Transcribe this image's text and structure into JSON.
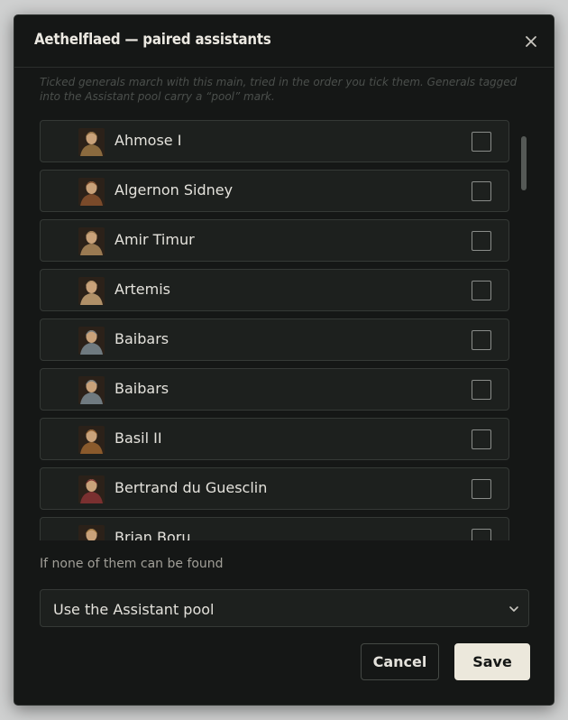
{
  "dialog": {
    "title": "Aethelflaed — paired assistants",
    "close_icon": "close-icon",
    "intro": "Ticked generals march with this main, tried in the order you tick them. Generals tagged into the Assistant pool carry a “pool” mark."
  },
  "generals": [
    {
      "name": "Ahmose I",
      "checked": false,
      "icon": "portrait-icon",
      "tone": "#8a6a3e"
    },
    {
      "name": "Algernon Sidney",
      "checked": false,
      "icon": "portrait-icon",
      "tone": "#7a4a2a"
    },
    {
      "name": "Amir Timur",
      "checked": false,
      "icon": "portrait-icon",
      "tone": "#9a7a52"
    },
    {
      "name": "Artemis",
      "checked": false,
      "icon": "portrait-icon",
      "tone": "#b09068"
    },
    {
      "name": "Baibars",
      "checked": false,
      "icon": "portrait-icon",
      "tone": "#6f7a80"
    },
    {
      "name": "Baibars",
      "checked": false,
      "icon": "portrait-icon",
      "tone": "#6f7a80"
    },
    {
      "name": "Basil II",
      "checked": false,
      "icon": "portrait-icon",
      "tone": "#8a5a2c"
    },
    {
      "name": "Bertrand du Guesclin",
      "checked": false,
      "icon": "portrait-icon",
      "tone": "#7a3030"
    },
    {
      "name": "Brian Boru",
      "checked": false,
      "icon": "portrait-icon",
      "tone": "#a07840"
    }
  ],
  "fallback": {
    "label": "If none of them can be found",
    "selected": "Use the Assistant pool",
    "icon": "chevron-down-icon"
  },
  "actions": {
    "cancel": "Cancel",
    "save": "Save"
  },
  "colors": {
    "background": "#151716",
    "row": "#1d201e",
    "border": "#353936",
    "text": "#e4e2dc",
    "save_button": "#ece8dc"
  }
}
